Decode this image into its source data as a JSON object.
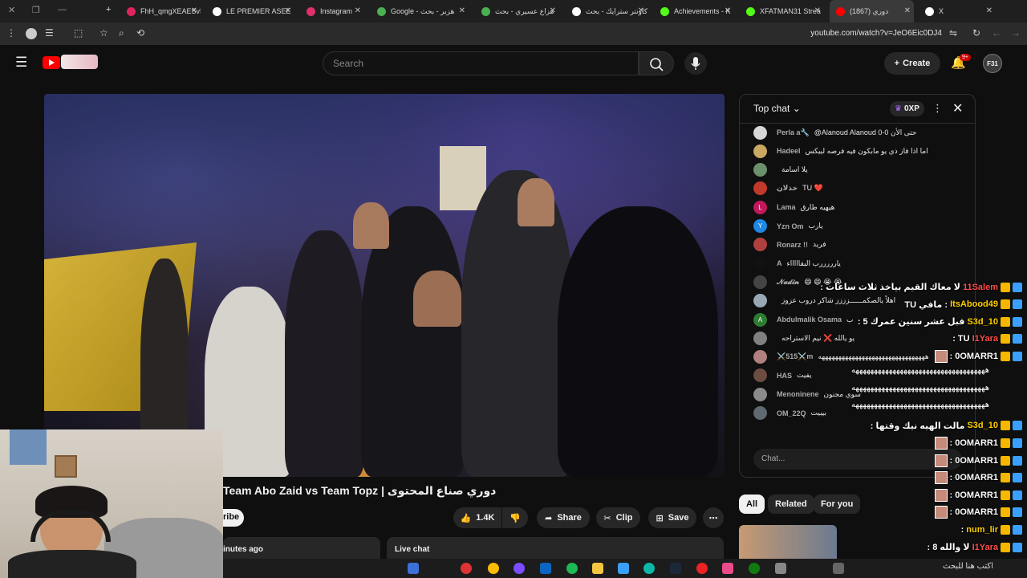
{
  "browser": {
    "tabs": [
      {
        "label": "FhH_qmgXEAESv5",
        "color": "#e0245e"
      },
      {
        "label": "LE PREMIER ASEE",
        "color": "#ffffff"
      },
      {
        "label": "Instagram",
        "color": "#e1306c"
      },
      {
        "label": "Google - هزبر - بحث",
        "color": "#4caf50"
      },
      {
        "label": "هزاع عسيري - بحث",
        "color": "#4caf50"
      },
      {
        "label": "كاونتر سترايك - بحث",
        "color": "#ffffff"
      },
      {
        "label": "Achievements - K",
        "color": "#53fc18"
      },
      {
        "label": "XFATMAN31 Strea",
        "color": "#53fc18"
      },
      {
        "label": "(1867) دوري",
        "color": "#ff0000"
      },
      {
        "label": "X",
        "color": "#ffffff"
      }
    ],
    "url": "youtube.com/watch?v=JeO6Eic0DJ4"
  },
  "header": {
    "search_placeholder": "Search",
    "create_label": "Create",
    "notif_count": "9+",
    "avatar_text": "F31"
  },
  "video": {
    "title": "دوري صناع المحتوى | Team Abo Zaid vs Team Topz",
    "subscribe_fragment": "ribe",
    "likes": "1.4K",
    "share_label": "Share",
    "clip_label": "Clip",
    "save_label": "Save",
    "more_label": "⋯",
    "published_fragment": "inutes ago",
    "live_chat_label": "Live chat"
  },
  "chat": {
    "title": "Top chat",
    "xp": "0XP",
    "input_placeholder": "Chat...",
    "messages": [
      {
        "name": "Perla a🔧",
        "text": "@Alanoud Alanoud 0-0 حتى الأن",
        "avatar_color": "#d7d7d7",
        "initial": ""
      },
      {
        "name": "Hadeel",
        "text": "اما اذا فاز ذي يو مابكون فيه فرصه لبيكس",
        "avatar_color": "#c9a860",
        "initial": ""
      },
      {
        "name": "",
        "text": "يلا  اسامة",
        "avatar_color": "#6c8f6c",
        "initial": ""
      },
      {
        "name": "خذلان",
        "text": "TU ❤️",
        "avatar_color": "#c0392b",
        "initial": ""
      },
      {
        "name": "Lama",
        "text": "هيهيه طارق",
        "avatar_color": "#c2185b",
        "initial": "L"
      },
      {
        "name": "Yzn Om",
        "text": "يارب",
        "avatar_color": "#1e88e5",
        "initial": "Y"
      },
      {
        "name": "Ronarz !!",
        "text": "فريد",
        "avatar_color": "#b04040",
        "initial": ""
      },
      {
        "name": "A",
        "text": "يارررررب البقاااااء",
        "avatar_color": "#111111",
        "initial": ""
      },
      {
        "name": "𝓝𝓪𝓭𝓲𝓷",
        "text": "😄 😄 😭 😭",
        "avatar_color": "#444444",
        "initial": ""
      },
      {
        "name": "",
        "text": "اهلاً يالصكمــــــزززز شاكر دروب عزوز",
        "avatar_color": "#9aa7b5",
        "initial": ""
      },
      {
        "name": "Abdulmalik Osama",
        "text": "ب",
        "avatar_color": "#2e7d32",
        "initial": "A"
      },
      {
        "name": "",
        "text": "يو يالله  ❌ نيم الاستراحه",
        "avatar_color": "#808080",
        "initial": ""
      },
      {
        "name": "⚔️515⚔️m",
        "text": "ههههههههههههههههههههههههههههههههه",
        "avatar_color": "#b08080",
        "initial": ""
      },
      {
        "name": "HAS",
        "text": "يفيت",
        "avatar_color": "#6d4c41",
        "initial": ""
      },
      {
        "name": "Menoninene",
        "text": "سوي مجنون",
        "avatar_color": "#8a8a8a",
        "initial": ""
      },
      {
        "name": "OM_22Q",
        "text": "بيبيت",
        "avatar_color": "#5e6a70",
        "initial": ""
      }
    ]
  },
  "chips": [
    {
      "label": "All",
      "selected": true
    },
    {
      "label": "Related",
      "selected": false
    },
    {
      "label": "For you",
      "selected": false
    }
  ],
  "overlay_chat": [
    {
      "name": "11Salem",
      "text": "لا معاك القيم بياخذ ثلاث ساعات :",
      "color": "#ff4d4d"
    },
    {
      "name": "ItsAbood49",
      "text": "TU مافي :",
      "color": "#ffd000"
    },
    {
      "name": "S3d_10",
      "text": "قبل عشر سنين عمرك 5 :",
      "color": "#ffd000"
    },
    {
      "name": "I1Yara",
      "text": ": TU",
      "color": "#ff4d4d"
    },
    {
      "name": "0OMARR1",
      "text": ":",
      "color": "#ffffff"
    },
    {
      "name": "",
      "text": "ههههههههههههههههههههههههههههههههههههه",
      "color": "#ffffff"
    },
    {
      "name": "",
      "text": "ههههههههههههههههههههههههههههههههههههه",
      "color": "#ffffff"
    },
    {
      "name": "",
      "text": "ههههههههههههههههههههههههههههههههههههه",
      "color": "#ffffff"
    },
    {
      "name": "S3d_10",
      "text": "مالت الهيه نيك وقتها :",
      "color": "#ffd000"
    },
    {
      "name": "0OMARR1",
      "text": ":",
      "color": "#ffffff"
    },
    {
      "name": "0OMARR1",
      "text": ":",
      "color": "#ffffff"
    },
    {
      "name": "0OMARR1",
      "text": ":",
      "color": "#ffffff"
    },
    {
      "name": "0OMARR1",
      "text": ":",
      "color": "#ffffff"
    },
    {
      "name": "0OMARR1",
      "text": ":",
      "color": "#ffffff"
    },
    {
      "name": "num_lir",
      "text": ":",
      "color": "#ffd000"
    },
    {
      "name": "I1Yara",
      "text": "لا والله 8 :",
      "color": "#ff4d4d"
    }
  ],
  "taskbar": {
    "search_text": "اكتب هنا للبحث"
  }
}
